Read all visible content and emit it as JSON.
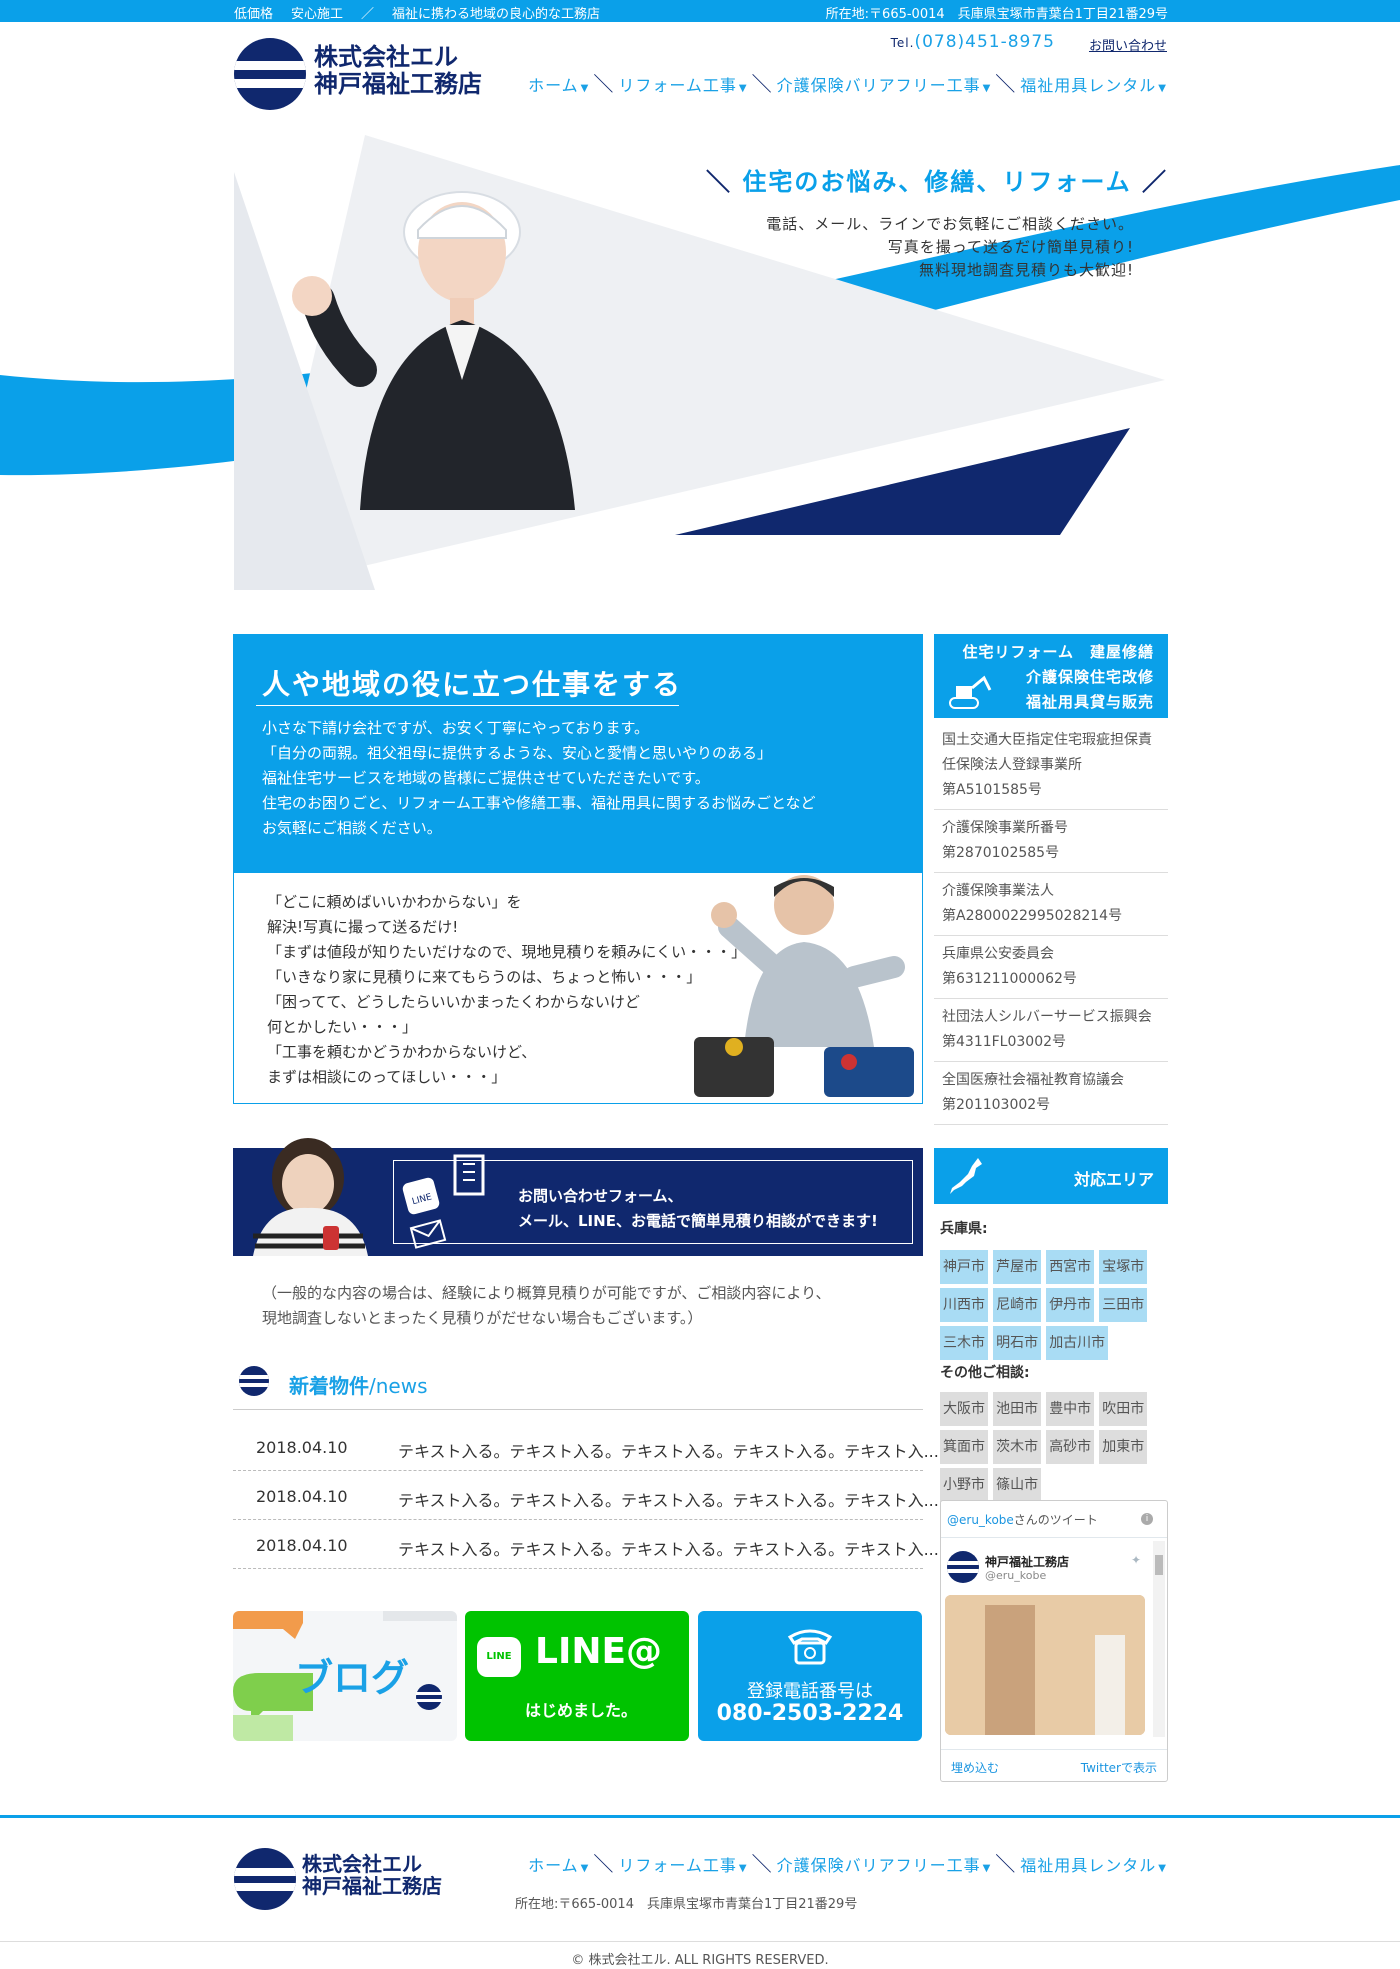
{
  "topbar": {
    "tags": [
      "低価格",
      "安心施工",
      "／",
      "福祉に携わる地域の良心的な工務店"
    ],
    "address": "所在地:〒665-0014　兵庫県宝塚市青葉台1丁目21番29号"
  },
  "header": {
    "company_line1": "株式会社エル",
    "company_line2": "神戸福祉工務店",
    "tel_prefix": "Tel.",
    "tel": "(078)451-8975",
    "contact_link": "お問い合わせ",
    "nav": [
      "ホーム",
      "リフォーム工事",
      "介護保険バリアフリー工事",
      "福祉用具レンタル"
    ]
  },
  "hero": {
    "headline": "住宅のお悩み、修繕、リフォーム",
    "lines": [
      "電話、メール、ラインでお気軽にご相談ください。",
      "写真を撮って送るだけ簡単見積り!",
      "無料現地調査見積りも大歓迎!"
    ]
  },
  "about": {
    "title": "人や地域の役に立つ仕事をする",
    "body": [
      "小さな下請け会社ですが、お安く丁寧にやっております。",
      "「自分の両親。祖父祖母に提供するような、安心と愛情と思いやりのある」",
      "福祉住宅サービスを地域の皆様にご提供させていただきたいです。",
      "住宅のお困りごと、リフォーム工事や修繕工事、福祉用具に関するお悩みごとなど",
      "お気軽にご相談ください。"
    ],
    "quotes": [
      "「どこに頼めばいいかわからない」を",
      "解決!写真に撮って送るだけ!",
      "「まずは値段が知りたいだけなので、現地見積りを頼みにくい・・・」",
      "「いきなり家に見積りに来てもらうのは、ちょっと怖い・・・」",
      "「困ってて、どうしたらいいかまったくわからないけど",
      "何とかしたい・・・」",
      "「工事を頼むかどうかわからないけど、",
      "まずは相談にのってほしい・・・」"
    ]
  },
  "sidebar": {
    "services": [
      "住宅リフォーム　建屋修繕",
      "介護保険住宅改修",
      "福祉用具貸与販売"
    ],
    "certs": [
      {
        "label": "国土交通大臣指定住宅瑕疵担保責任保険法人登録事業所",
        "value": "第A5101585号"
      },
      {
        "label": "介護保険事業所番号",
        "value": "第2870102585号"
      },
      {
        "label": "介護保険事業法人",
        "value": "第A2800022995028214号"
      },
      {
        "label": "兵庫県公安委員会",
        "value": "第631211000062号"
      },
      {
        "label": "社団法人シルバーサービス振興会",
        "value": "第4311FL03002号"
      },
      {
        "label": "全国医療社会福祉教育協議会",
        "value": "第201103002号"
      }
    ],
    "area_title": "対応エリア",
    "hyogo_label": "兵庫県:",
    "hyogo_cities": [
      "神戸市",
      "芦屋市",
      "西宮市",
      "宝塚市",
      "川西市",
      "尼崎市",
      "伊丹市",
      "三田市",
      "三木市",
      "明石市",
      "加古川市"
    ],
    "other_label": "その他ご相談:",
    "other_cities": [
      "大阪市",
      "池田市",
      "豊中市",
      "吹田市",
      "箕面市",
      "茨木市",
      "高砂市",
      "加東市",
      "小野市",
      "篠山市"
    ],
    "twitter": {
      "handle": "@eru_kobe",
      "title_suffix": "さんのツイート",
      "user_name": "神戸福祉工務店",
      "user_handle": "@eru_kobe",
      "embed": "埋め込む",
      "view": "Twitterで表示"
    }
  },
  "contact_banner": {
    "line_badge": "LINE",
    "line1": "お問い合わせフォーム、",
    "line2": "メール、LINE、お電話で簡単見積り相談ができます!"
  },
  "note": [
    "（一般的な内容の場合は、経験により概算見積りが可能ですが、ご相談内容により、",
    "現地調査しないとまったく見積りがだせない場合もございます。）"
  ],
  "news": {
    "title": "新着物件",
    "title_en": "/news",
    "items": [
      {
        "date": "2018.04.10",
        "text": "テキスト入る。テキスト入る。テキスト入る。テキスト入る。テキスト入..."
      },
      {
        "date": "2018.04.10",
        "text": "テキスト入る。テキスト入る。テキスト入る。テキスト入る。テキスト入..."
      },
      {
        "date": "2018.04.10",
        "text": "テキスト入る。テキスト入る。テキスト入る。テキスト入る。テキスト入..."
      }
    ]
  },
  "buttons": {
    "blog": "ブログ",
    "line_title": "LINE@",
    "line_badge": "LINE",
    "line_sub": "はじめました。",
    "phone_label": "登録電話番号は",
    "phone": "080-2503-2224"
  },
  "footer": {
    "company_line1": "株式会社エル",
    "company_line2": "神戸福祉工務店",
    "nav": [
      "ホーム",
      "リフォーム工事",
      "介護保険バリアフリー工事",
      "福祉用具レンタル"
    ],
    "address": "所在地:〒665-0014　兵庫県宝塚市青葉台1丁目21番29号",
    "copyright": "© 株式会社エル. ALL RIGHTS RESERVED."
  },
  "colors": {
    "primary": "#0aa0e9",
    "navy": "#10286e",
    "line_green": "#00c300"
  }
}
